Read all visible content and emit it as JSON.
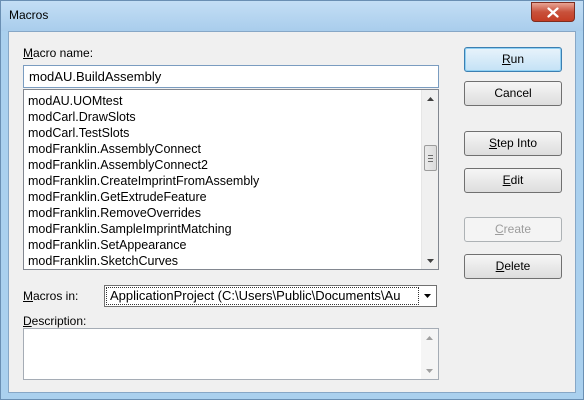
{
  "window": {
    "title": "Macros"
  },
  "macro_name": {
    "label_prefix": "",
    "label_accel": "M",
    "label_rest": "acro name:",
    "value": "modAU.BuildAssembly"
  },
  "macro_list": {
    "items": [
      "modAU.UOMtest",
      "modCarl.DrawSlots",
      "modCarl.TestSlots",
      "modFranklin.AssemblyConnect",
      "modFranklin.AssemblyConnect2",
      "modFranklin.CreateImprintFromAssembly",
      "modFranklin.GetExtrudeFeature",
      "modFranklin.RemoveOverrides",
      "modFranklin.SampleImprintMatching",
      "modFranklin.SetAppearance",
      "modFranklin.SketchCurves"
    ]
  },
  "buttons": {
    "run": {
      "accel": "R",
      "rest": "un"
    },
    "cancel": {
      "label": "Cancel"
    },
    "step_into": {
      "accel": "S",
      "rest": "tep Into"
    },
    "edit": {
      "accel": "E",
      "rest": "dit"
    },
    "create": {
      "accel": "C",
      "rest": "reate"
    },
    "delete": {
      "accel": "D",
      "rest": "elete"
    }
  },
  "macros_in": {
    "label_accel": "M",
    "label_rest": "acros in:",
    "selected": "ApplicationProject (C:\\Users\\Public\\Documents\\Au"
  },
  "description": {
    "label_prefix": "",
    "label_accel": "D",
    "label_rest": "escription:",
    "value": ""
  }
}
